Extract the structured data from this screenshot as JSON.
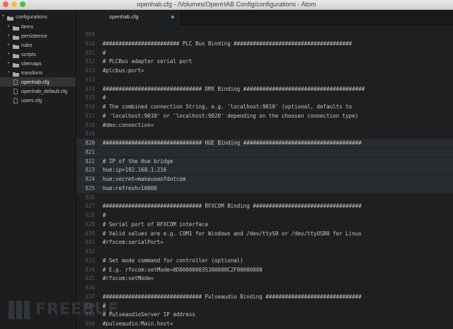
{
  "window": {
    "title": "openhab.cfg - /Volumes/OpenHAB Config/configurations - Atom",
    "controls": [
      "close-button",
      "minimize-button",
      "zoom-button"
    ],
    "control_colors": [
      "#fc605c",
      "#fdbc40",
      "#34c84a"
    ]
  },
  "sidebar": {
    "root": "configurations",
    "items": [
      {
        "label": "items",
        "type": "folder"
      },
      {
        "label": "persistence",
        "type": "folder"
      },
      {
        "label": "rules",
        "type": "folder"
      },
      {
        "label": "scripts",
        "type": "folder"
      },
      {
        "label": "sitemaps",
        "type": "folder"
      },
      {
        "label": "transform",
        "type": "folder"
      },
      {
        "label": "openhab.cfg",
        "type": "file",
        "selected": true
      },
      {
        "label": "openhab_default.cfg",
        "type": "file"
      },
      {
        "label": "users.cfg",
        "type": "file"
      }
    ]
  },
  "tab": {
    "label": "openhab.cfg",
    "modified": true
  },
  "editor": {
    "lines": [
      {
        "num": "809",
        "text": ""
      },
      {
        "num": "810",
        "text": "######################## PLC Bus Binding #####################################"
      },
      {
        "num": "811",
        "text": "#"
      },
      {
        "num": "812",
        "text": "# PLCBus adapter serial port"
      },
      {
        "num": "813",
        "text": "#plcbus:port="
      },
      {
        "num": "813",
        "text": ""
      },
      {
        "num": "814",
        "text": "############################### DMX Binding ######################################"
      },
      {
        "num": "815",
        "text": "#"
      },
      {
        "num": "816",
        "text": "# The combined connection String, e.g. 'localhost:9010' (optional, defaults to"
      },
      {
        "num": "817",
        "text": "# 'localhost:9010' or 'localhost:9020' depending on the choosen connection type)"
      },
      {
        "num": "818",
        "text": "#dmx:connection="
      },
      {
        "num": "819",
        "text": ""
      },
      {
        "num": "820",
        "text": "############################### HUE Binding #####################################",
        "hl": true
      },
      {
        "num": "821",
        "text": "",
        "hl": true
      },
      {
        "num": "822",
        "text": "# IP of the Hue bridge",
        "hl": true
      },
      {
        "num": "823",
        "text": "hue:ip=192.168.1.216",
        "hl": true
      },
      {
        "num": "824",
        "text": "hue:secret=makeuseofdotcom",
        "hl": true
      },
      {
        "num": "825",
        "text": "hue:refresh=10000",
        "hl": true
      },
      {
        "num": "826",
        "text": ""
      },
      {
        "num": "827",
        "text": "############################### RFXCOM Binding ##################################"
      },
      {
        "num": "828",
        "text": "#"
      },
      {
        "num": "829",
        "text": "# Serial port of RFXCOM interface"
      },
      {
        "num": "830",
        "text": "# Valid values are e.g. COM1 for Windows and /dev/ttyS0 or /dev/ttyUSB0 for Linux"
      },
      {
        "num": "831",
        "text": "#rfxcom:serialPort="
      },
      {
        "num": "832",
        "text": ""
      },
      {
        "num": "833",
        "text": "# Set mode command for controller (optional)"
      },
      {
        "num": "834",
        "text": "# E.g. rfxcom:setMode=0D000000035300000C2F00000000"
      },
      {
        "num": "835",
        "text": "#rfxcom:setMode="
      },
      {
        "num": "836",
        "text": ""
      },
      {
        "num": "837",
        "text": "############################### Pulseaudio Binding ##############################"
      },
      {
        "num": "838",
        "text": "#"
      },
      {
        "num": "839",
        "text": "# PulseaudioServer IP address"
      },
      {
        "num": "840",
        "text": "#pulseaudio:Main.host="
      }
    ]
  },
  "watermark": {
    "text": "FREEBUF"
  },
  "colors": {
    "background": "#1d1f21",
    "highlight": "#282c30",
    "accent": "#5e9ad6"
  }
}
